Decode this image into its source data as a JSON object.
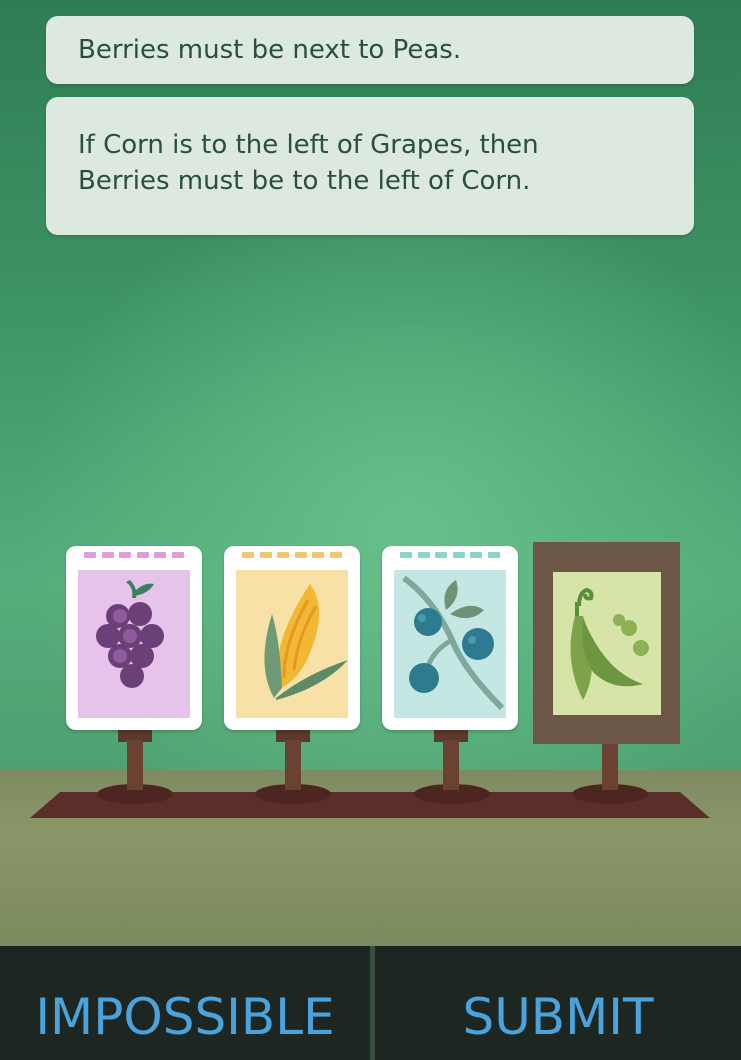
{
  "clues": [
    {
      "text": "Berries must be next to Peas."
    },
    {
      "lines": [
        "If Corn is to the left of Grapes, then",
        "Berries must be to the left of Corn."
      ]
    }
  ],
  "cards": [
    {
      "name": "grapes",
      "icon": "grapes-icon",
      "bg": "#e5c3ea",
      "dash": "#df9ce0"
    },
    {
      "name": "corn",
      "icon": "corn-icon",
      "bg": "#f7e1a6",
      "dash": "#f0c66f"
    },
    {
      "name": "berries",
      "icon": "berries-icon",
      "bg": "#c4e7e3",
      "dash": "#8bd4cc"
    },
    {
      "name": "peas",
      "icon": "peas-icon",
      "bg": "#d6e5a7",
      "selected": true
    }
  ],
  "buttons": {
    "impossible": "IMPOSSIBLE",
    "submit": "SUBMIT"
  },
  "colors": {
    "button_text": "#4aa3dc",
    "button_bg": "#1d2620"
  }
}
